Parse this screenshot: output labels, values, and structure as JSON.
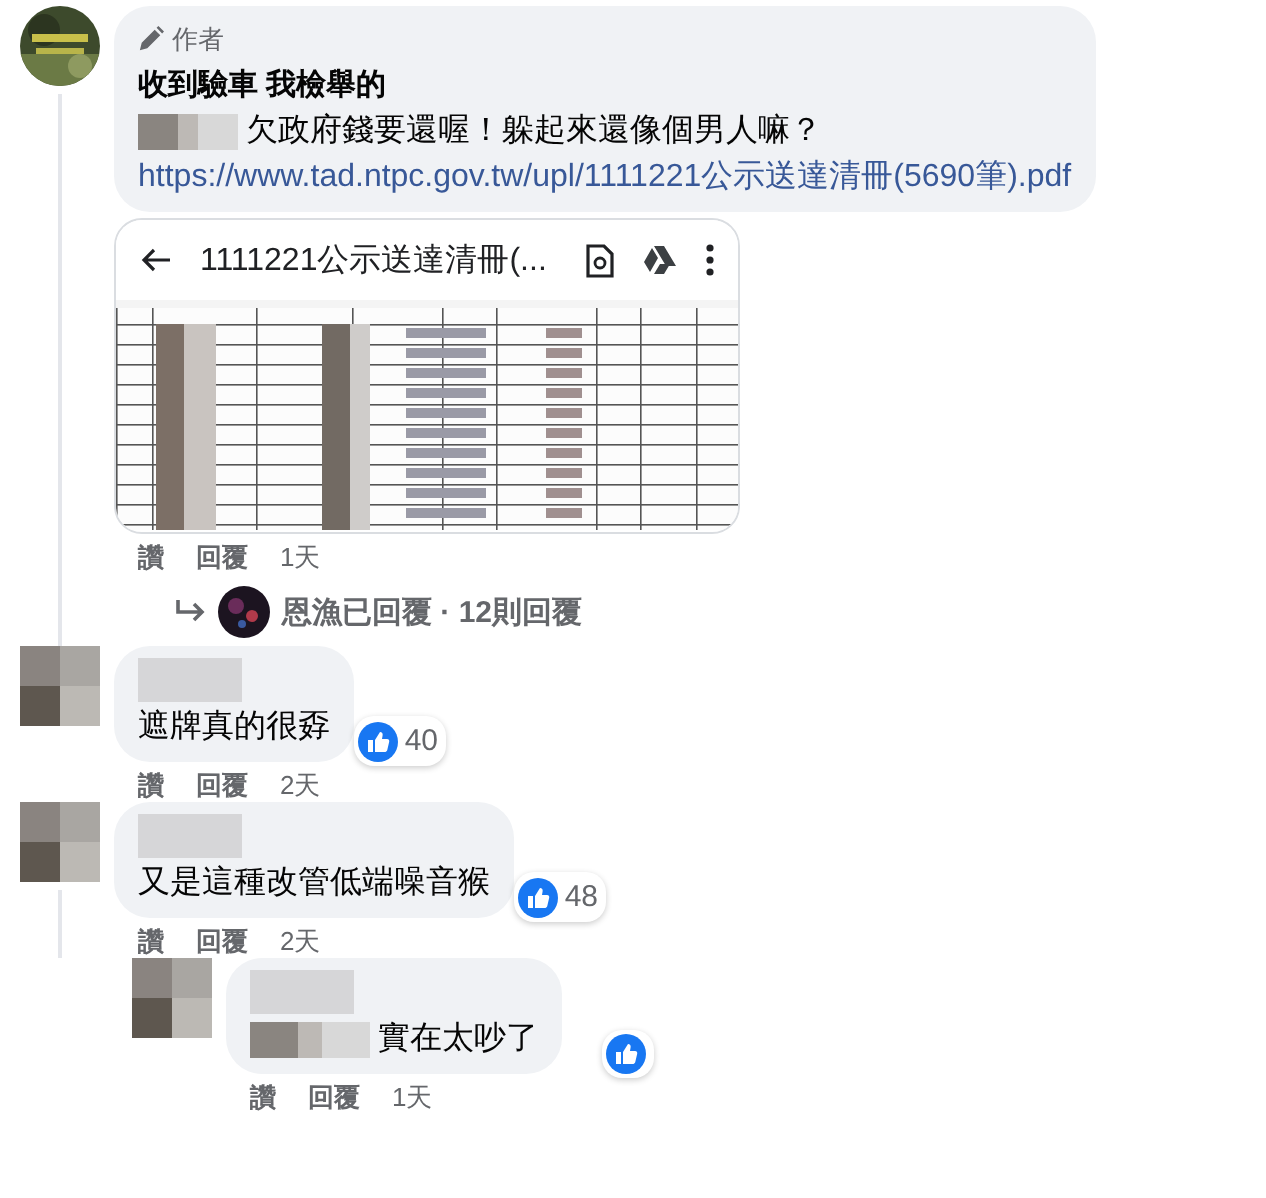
{
  "comments": [
    {
      "author_badge": "作者",
      "name": "收到驗車 我檢舉的",
      "name_blurred": false,
      "text": "欠政府錢要還喔！躲起來還像個男人嘛？",
      "text_prefix_blurred": true,
      "link": "https://www.tad.ntpc.gov.tw/upl/1111221公示送達清冊(5690筆).pdf",
      "avatar": {
        "kind": "picture"
      },
      "attachment": {
        "title": "1111221公示送達清冊(..."
      },
      "actions": [
        "讚",
        "回覆"
      ],
      "time": "1天",
      "replies_summary": {
        "text": "恩漁已回覆 · 12則回覆"
      }
    },
    {
      "name_blurred": true,
      "text": "遮牌真的很孬",
      "text_prefix_blurred": false,
      "avatar": {
        "kind": "mosaic"
      },
      "reaction": {
        "count": "40"
      },
      "actions": [
        "讚",
        "回覆"
      ],
      "time": "2天"
    },
    {
      "name_blurred": true,
      "text": "又是這種改管低端噪音猴",
      "text_prefix_blurred": false,
      "avatar": {
        "kind": "mosaic"
      },
      "reaction": {
        "count": "48"
      },
      "actions": [
        "讚",
        "回覆"
      ],
      "time": "2天",
      "replies": [
        {
          "name_blurred": true,
          "text": "實在太吵了",
          "text_prefix_blurred": true,
          "avatar": {
            "kind": "mosaic"
          },
          "reaction": {
            "kind": "like"
          },
          "actions": [
            "讚",
            "回覆"
          ],
          "time": "1天"
        }
      ]
    }
  ]
}
